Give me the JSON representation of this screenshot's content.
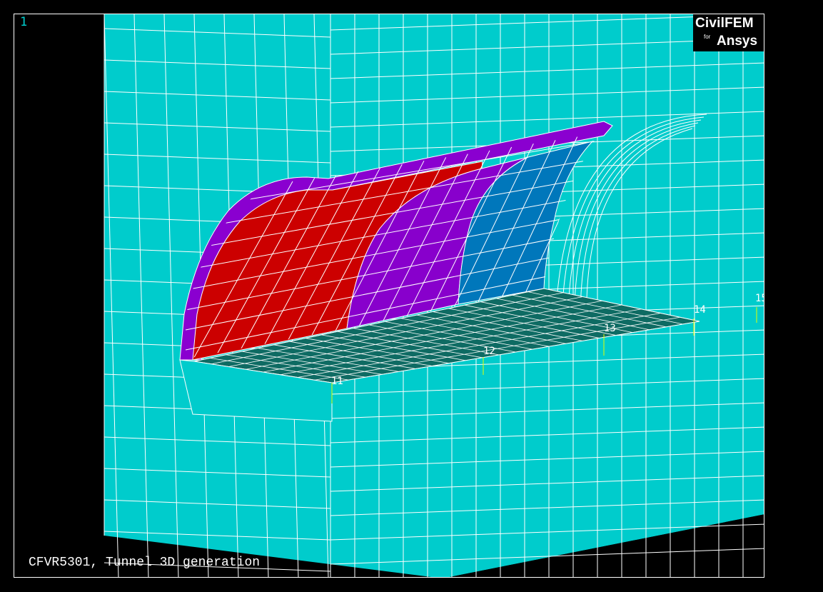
{
  "viewport": {
    "window_number": "1",
    "caption": "CFVR5301, Tunnel 3D generation"
  },
  "logo": {
    "brand": "CivilFEM",
    "for": "for",
    "product": "Ansys"
  },
  "stations": [
    {
      "label": "11"
    },
    {
      "label": "12"
    },
    {
      "label": "13"
    },
    {
      "label": "14"
    },
    {
      "label": "15"
    }
  ],
  "colors": {
    "soil": "#00cccc",
    "mesh": "#ffffff",
    "slab": "#0e6b63",
    "lining_outer": "#8a00d0",
    "phase_1": "#cc0000",
    "phase_2": "#8800cc",
    "phase_3": "#0077bb",
    "station_marker": "#e6ff00",
    "background": "#000000"
  }
}
